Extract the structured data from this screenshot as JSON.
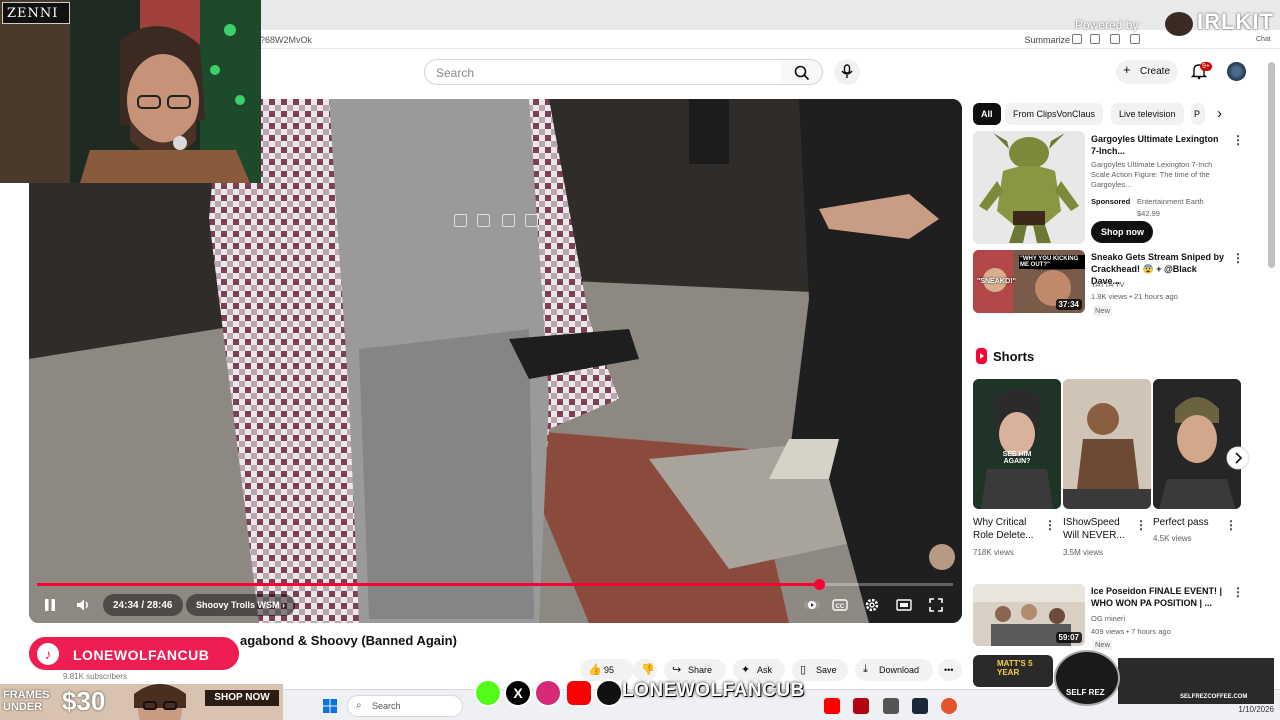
{
  "browser": {
    "url_fragment": "?68W2MvOk",
    "summarize_label": "Summarize",
    "chat_label": "Chat"
  },
  "header": {
    "search_placeholder": "Search",
    "create_label": "Create",
    "notification_count": "9+"
  },
  "video": {
    "time": "24:34 / 28:46",
    "chapter": "Shoovy Trolls WSM",
    "progress_fraction": 0.854,
    "title_visible": "agabond & Shoovy (Banned Again)",
    "subscribers": "9.81K subscribers",
    "actions": {
      "likes": "95",
      "share": "Share",
      "ask": "Ask",
      "save": "Save",
      "download": "Download"
    }
  },
  "chips": [
    "All",
    "From ClipsVonClaus",
    "Live television",
    "P"
  ],
  "sidebar": {
    "ad": {
      "title": "Gargoyles Ultimate Lexington 7-Inch...",
      "description": "Gargoyles Ultimate Lexington 7-Inch Scale Action Figure: The time of the Gargoyles...",
      "sponsor": "Sponsored",
      "advertiser": "Entertainment Earth",
      "price": "$42.99",
      "cta": "Shop now"
    },
    "rec1": {
      "title": "Sneako Gets Stream Sniped by Crackhead! 😨 + @Black Dave...",
      "channel": "YATTA TV",
      "meta": "1.8K views • 21 hours ago",
      "badge": "New",
      "duration": "37:34",
      "thumb_text_1": "\"WHY YOU KICKING ME OUT?\"",
      "thumb_text_2": "\"SNEAKO!\""
    },
    "shorts_heading": "Shorts",
    "shorts": [
      {
        "title": "Why Critical Role Delete...",
        "views": "718K views",
        "thumb_text": "SEE HIM AGAIN?"
      },
      {
        "title": "IShowSpeed Will NEVER...",
        "views": "3.5M views",
        "thumb_text": ""
      },
      {
        "title": "Perfect pass",
        "views": "4.5K views",
        "thumb_text": ""
      }
    ],
    "rec2": {
      "title": "Ice Poseidon FINALE EVENT! | WHO WON PA POSITION | ...",
      "channel": "OG mineri",
      "meta": "409 views • 7 hours ago",
      "badge": "New",
      "duration": "59:07"
    },
    "rec3": {
      "thumb_text": "MATT'S 5 YEAR"
    }
  },
  "overlays": {
    "zenni": "ZENNI",
    "powered_by": "Powered by",
    "irl_logo": "IRLKIT",
    "tiktok_handle": "LONEWOLFANCUB",
    "ad_line1": "FRAMES",
    "ad_line2": "UNDER",
    "ad_price": "$30",
    "ad_cta": "SHOP NOW",
    "social_handle": "LONEWOLFANCUB",
    "selfrez": "SELF REZ",
    "selfrez_url": "SELFREZCOFFEE.COM"
  },
  "taskbar": {
    "search_placeholder": "Search",
    "date": "1/10/2026"
  },
  "colors": {
    "yt_red": "#ff0033",
    "tiktok_pink": "#ee1d52"
  }
}
